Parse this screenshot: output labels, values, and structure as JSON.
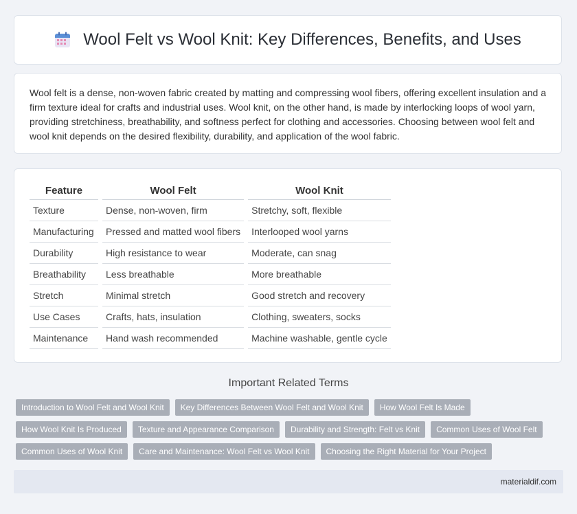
{
  "header": {
    "icon": "calendar-icon",
    "title": "Wool Felt vs Wool Knit: Key Differences, Benefits, and Uses"
  },
  "intro": {
    "text": "Wool felt is a dense, non-woven fabric created by matting and compressing wool fibers, offering excellent insulation and a firm texture ideal for crafts and industrial uses. Wool knit, on the other hand, is made by interlocking loops of wool yarn, providing stretchiness, breathability, and softness perfect for clothing and accessories. Choosing between wool felt and wool knit depends on the desired flexibility, durability, and application of the wool fabric."
  },
  "table": {
    "headers": [
      "Feature",
      "Wool Felt",
      "Wool Knit"
    ],
    "rows": [
      [
        "Texture",
        "Dense, non-woven, firm",
        "Stretchy, soft, flexible"
      ],
      [
        "Manufacturing",
        "Pressed and matted wool fibers",
        "Interlooped wool yarns"
      ],
      [
        "Durability",
        "High resistance to wear",
        "Moderate, can snag"
      ],
      [
        "Breathability",
        "Less breathable",
        "More breathable"
      ],
      [
        "Stretch",
        "Minimal stretch",
        "Good stretch and recovery"
      ],
      [
        "Use Cases",
        "Crafts, hats, insulation",
        "Clothing, sweaters, socks"
      ],
      [
        "Maintenance",
        "Hand wash recommended",
        "Machine washable, gentle cycle"
      ]
    ]
  },
  "related": {
    "title": "Important Related Terms",
    "rows": [
      [
        "Introduction to Wool Felt and Wool Knit",
        "Key Differences Between Wool Felt and Wool Knit",
        "How Wool Felt Is Made"
      ],
      [
        "How Wool Knit Is Produced",
        "Texture and Appearance Comparison",
        "Durability and Strength: Felt vs Knit",
        "Common Uses of Wool Felt"
      ],
      [
        "Common Uses of Wool Knit",
        "Care and Maintenance: Wool Felt vs Wool Knit",
        "Choosing the Right Material for Your Project"
      ]
    ]
  },
  "footer": {
    "text": "materialdif.com"
  }
}
